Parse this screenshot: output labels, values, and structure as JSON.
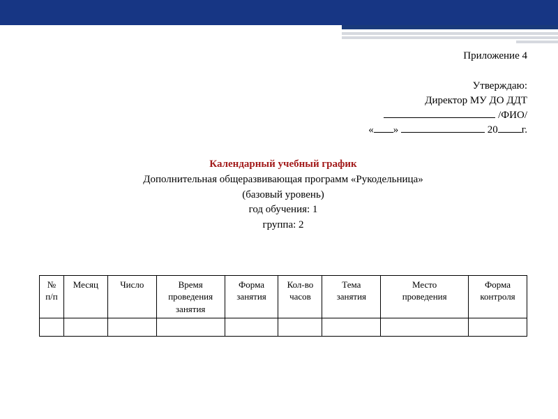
{
  "appendix": "Приложение 4",
  "approval": {
    "approve": "Утверждаю:",
    "director": "Директор МУ ДО ДДТ",
    "fio_suffix": " /ФИО/",
    "date_open": "«",
    "date_mid": "»  ",
    "date_year_prefix": " 20",
    "date_year_suffix": "г."
  },
  "title": {
    "main": "Календарный учебный график",
    "program": "Дополнительная общеразвивающая программ «Рукодельница»",
    "level": "(базовый уровень)",
    "year": "год обучения: 1",
    "group": "группа: 2"
  },
  "columns": {
    "c0a": "№",
    "c0b": "п/п",
    "c1": "Месяц",
    "c2": "Число",
    "c3a": "Время",
    "c3b": "проведения",
    "c3c": "занятия",
    "c4a": "Форма",
    "c4b": "занятия",
    "c5a": "Кол-во",
    "c5b": "часов",
    "c6a": "Тема",
    "c6b": "занятия",
    "c7a": "Место",
    "c7b": "проведения",
    "c8a": "Форма",
    "c8b": "контроля"
  }
}
